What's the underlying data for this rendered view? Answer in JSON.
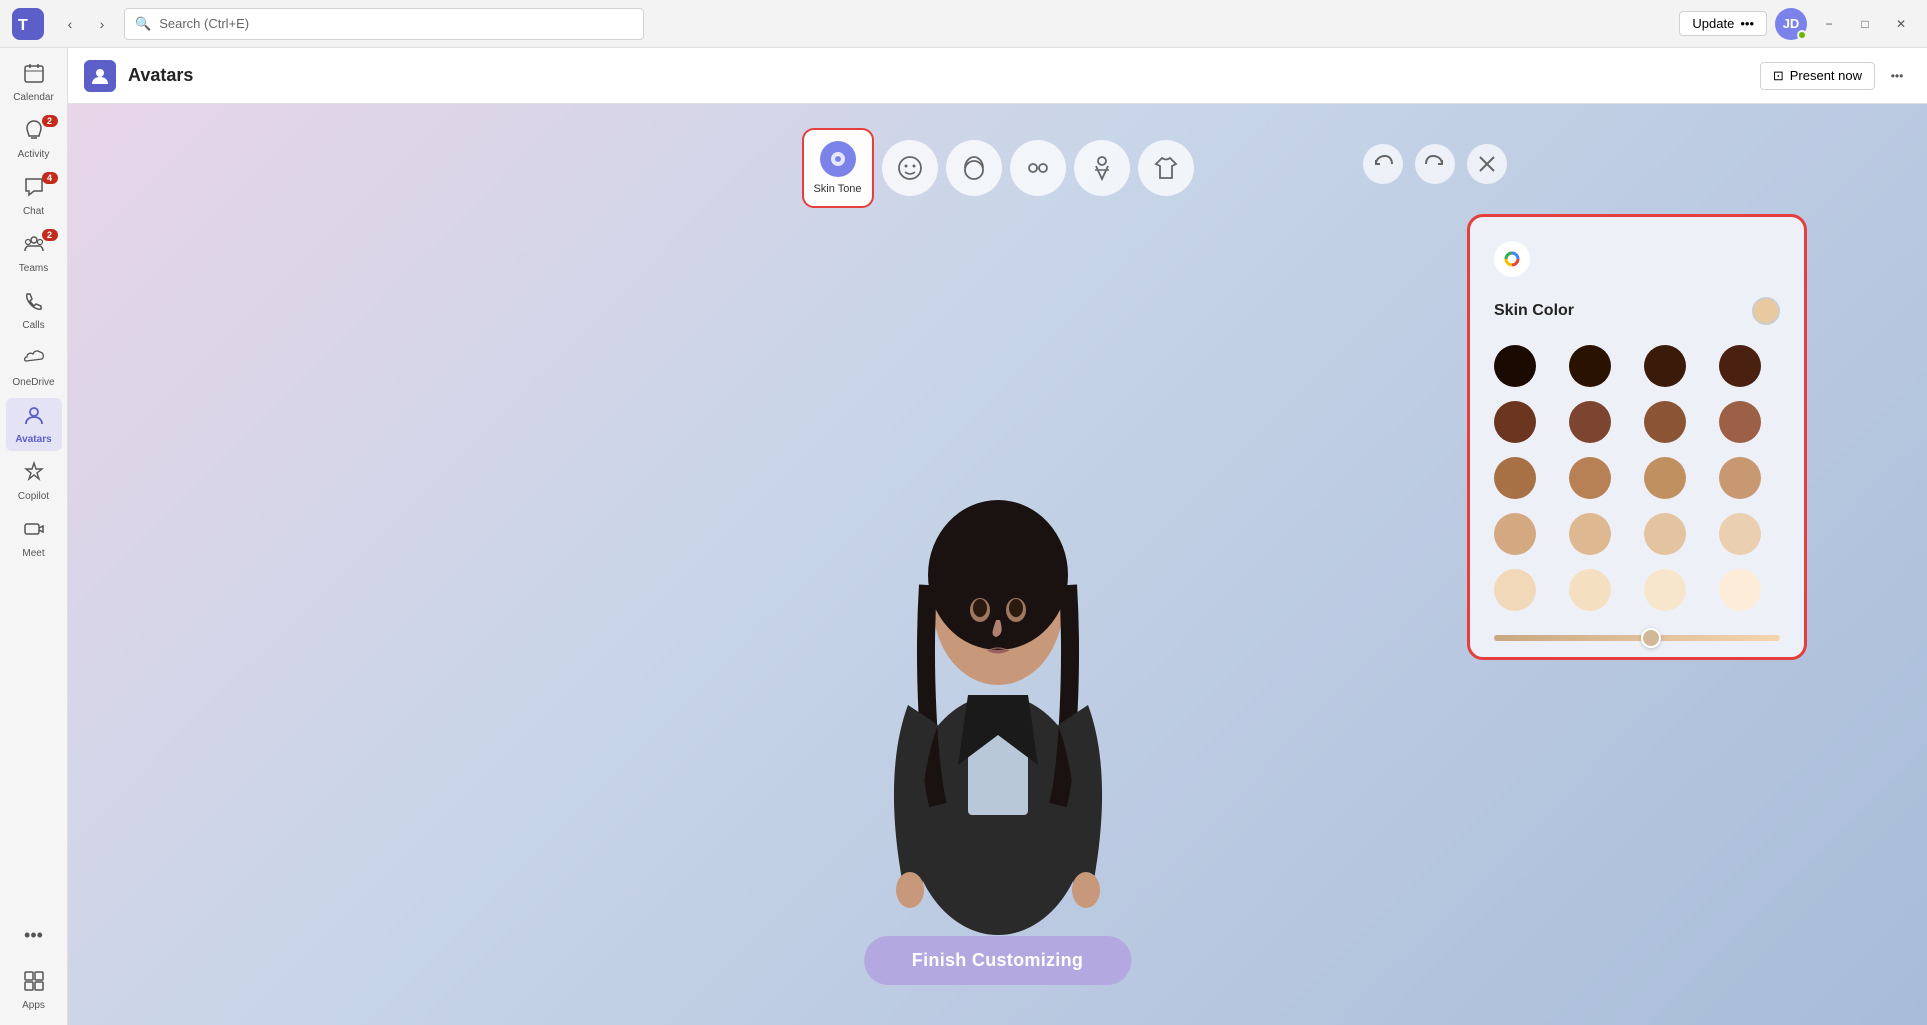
{
  "titlebar": {
    "logo": "T",
    "search_placeholder": "Search (Ctrl+E)",
    "update_label": "Update",
    "update_dots": "•••",
    "minimize_label": "−",
    "maximize_label": "□",
    "close_label": "✕"
  },
  "sidebar": {
    "items": [
      {
        "id": "calendar",
        "label": "Calendar",
        "icon": "📅",
        "badge": null,
        "active": false
      },
      {
        "id": "activity",
        "label": "Activity",
        "icon": "🔔",
        "badge": "2",
        "active": false
      },
      {
        "id": "chat",
        "label": "Chat",
        "icon": "💬",
        "badge": "4",
        "active": false
      },
      {
        "id": "teams",
        "label": "Teams",
        "icon": "👥",
        "badge": "2",
        "active": false
      },
      {
        "id": "calls",
        "label": "Calls",
        "icon": "📞",
        "badge": null,
        "active": false
      },
      {
        "id": "onedrive",
        "label": "OneDrive",
        "icon": "☁",
        "badge": null,
        "active": false
      },
      {
        "id": "avatars",
        "label": "Avatars",
        "icon": "👤",
        "badge": null,
        "active": true
      },
      {
        "id": "copilot",
        "label": "Copilot",
        "icon": "✦",
        "badge": null,
        "active": false
      },
      {
        "id": "meet",
        "label": "Meet",
        "icon": "📹",
        "badge": null,
        "active": false
      }
    ],
    "more_label": "•••",
    "apps_label": "Apps",
    "apps_icon": "⊞"
  },
  "content_header": {
    "icon": "👤",
    "title": "Avatars",
    "present_now_label": "Present now",
    "present_icon": "⊡",
    "more_icon": "•••"
  },
  "toolbar": {
    "items": [
      {
        "id": "skin-tone",
        "label": "Skin Tone",
        "icon": "🎨",
        "selected": true
      },
      {
        "id": "face",
        "label": "",
        "icon": "😊",
        "selected": false
      },
      {
        "id": "hair",
        "label": "",
        "icon": "💇",
        "selected": false
      },
      {
        "id": "features",
        "label": "",
        "icon": "👁",
        "selected": false
      },
      {
        "id": "body",
        "label": "",
        "icon": "🤸",
        "selected": false
      },
      {
        "id": "clothing",
        "label": "",
        "icon": "👕",
        "selected": false
      }
    ]
  },
  "toolbar_actions": {
    "undo_label": "undo",
    "redo_label": "redo",
    "close_label": "close"
  },
  "finish_btn": {
    "label": "Finish Customizing"
  },
  "skin_panel": {
    "title": "Skin Color",
    "google_icon": "⬤",
    "colors": [
      "#1a0a00",
      "#2a1200",
      "#3a1a08",
      "#4a2010",
      "#6b3520",
      "#7d4530",
      "#8b5535",
      "#9b6045",
      "#a87045",
      "#b88055",
      "#c09060",
      "#c89870",
      "#d4a880",
      "#ddb890",
      "#e4c4a0",
      "#eacfb0",
      "#f0d8b8",
      "#f4dfc0",
      "#f8e6cc",
      "#fcecd8"
    ],
    "selected_color": "#e8c9a0",
    "slider_value": 55
  }
}
